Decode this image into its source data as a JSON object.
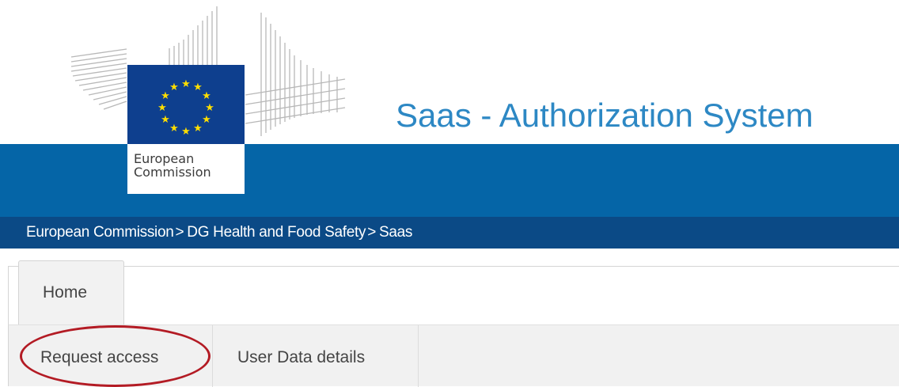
{
  "header": {
    "logo_line1": "European",
    "logo_line2": "Commission",
    "site_title": "Saas - Authorization System",
    "colors": {
      "band": "#0565a7",
      "breadcrumb_bar": "#0b4a86",
      "title": "#2d88c4",
      "flag": "#0e3f8e",
      "stars": "#ffde00"
    }
  },
  "breadcrumb": {
    "separator": ">",
    "items": [
      "European Commission",
      "DG Health and Food Safety",
      "Saas"
    ]
  },
  "nav": {
    "tabs": [
      {
        "label": "Home",
        "active": true
      }
    ]
  },
  "subnav": {
    "items": [
      {
        "label": "Request access",
        "highlighted": true
      },
      {
        "label": "User Data details"
      }
    ],
    "highlight_color": "#b31b24"
  }
}
